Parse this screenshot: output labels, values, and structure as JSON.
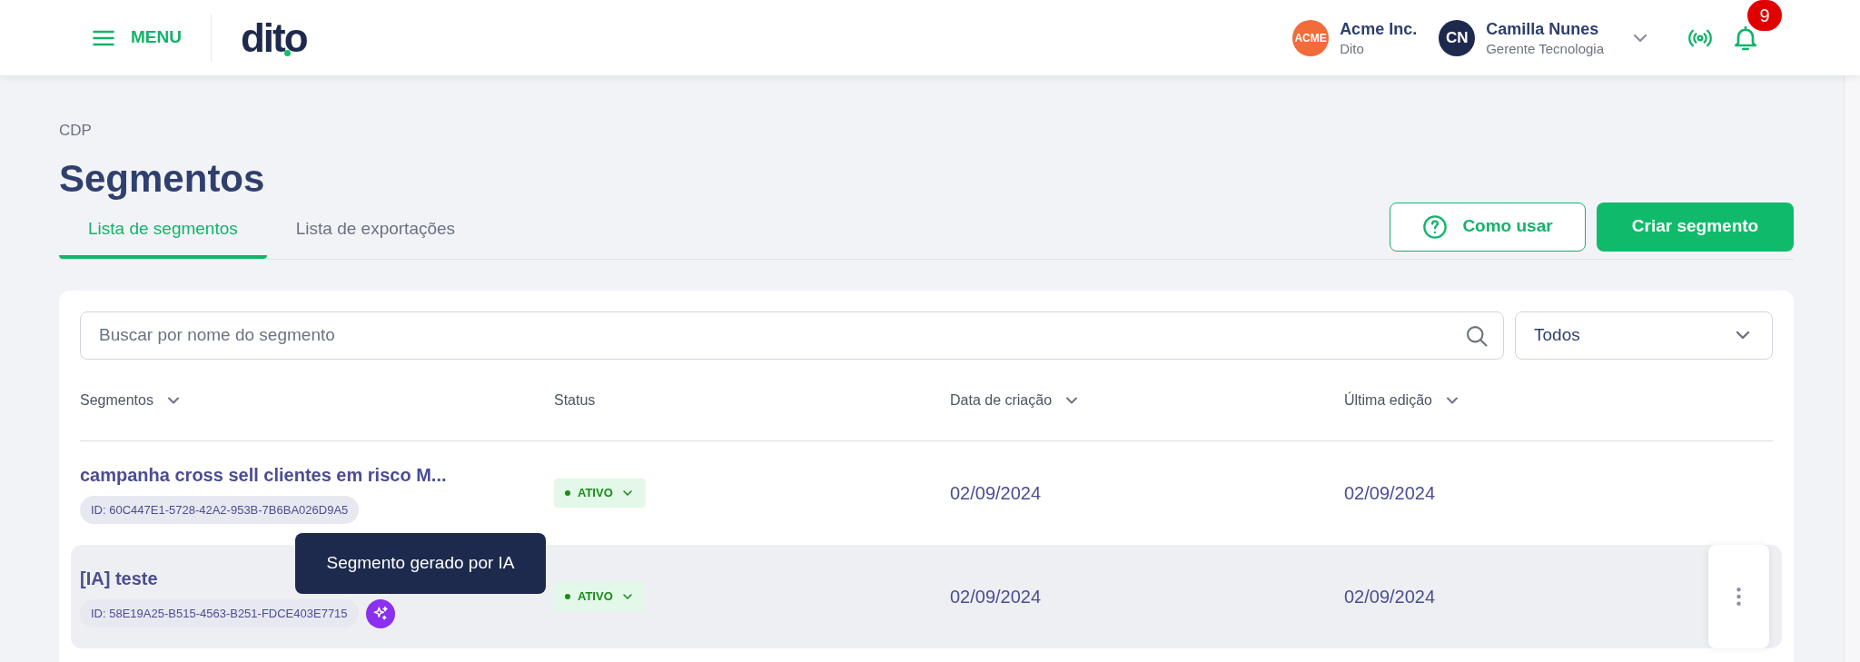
{
  "header": {
    "menu_label": "MENU",
    "logo": "dito",
    "org": {
      "avatar": "ACME",
      "name": "Acme Inc.",
      "subtitle": "Dito"
    },
    "user": {
      "initials": "CN",
      "name": "Camilla Nunes",
      "role": "Gerente Tecnologia"
    },
    "notifications": "9"
  },
  "breadcrumb": "CDP",
  "title": "Segmentos",
  "tabs": [
    {
      "label": "Lista de segmentos",
      "selected": true
    },
    {
      "label": "Lista de exportações",
      "selected": false
    }
  ],
  "buttons": [
    {
      "label": "Como usar",
      "kind": "outline"
    },
    {
      "label": "Criar segmento",
      "kind": "primary"
    }
  ],
  "search": {
    "placeholder": "Buscar por nome do segmento"
  },
  "filter": {
    "value": "Todos"
  },
  "columns": [
    {
      "label": "Segmentos",
      "sortable": true
    },
    {
      "label": "Status",
      "sortable": false
    },
    {
      "label": "Data de criação",
      "sortable": true
    },
    {
      "label": "Última edição",
      "sortable": true
    }
  ],
  "rows": [
    {
      "name": "campanha cross sell clientes em risco M...",
      "id": "ID: 60C447E1-5728-42A2-953B-7B6BA026D9A5",
      "ai": false,
      "status": "ATIVO",
      "created": "02/09/2024",
      "edited": "02/09/2024",
      "hovered": false
    },
    {
      "name": "[IA] teste",
      "id": "ID: 58E19A25-B515-4563-B251-FDCE403E7715",
      "ai": true,
      "status": "ATIVO",
      "created": "02/09/2024",
      "edited": "02/09/2024",
      "hovered": true,
      "tooltip": "Segmento gerado por IA"
    }
  ]
}
